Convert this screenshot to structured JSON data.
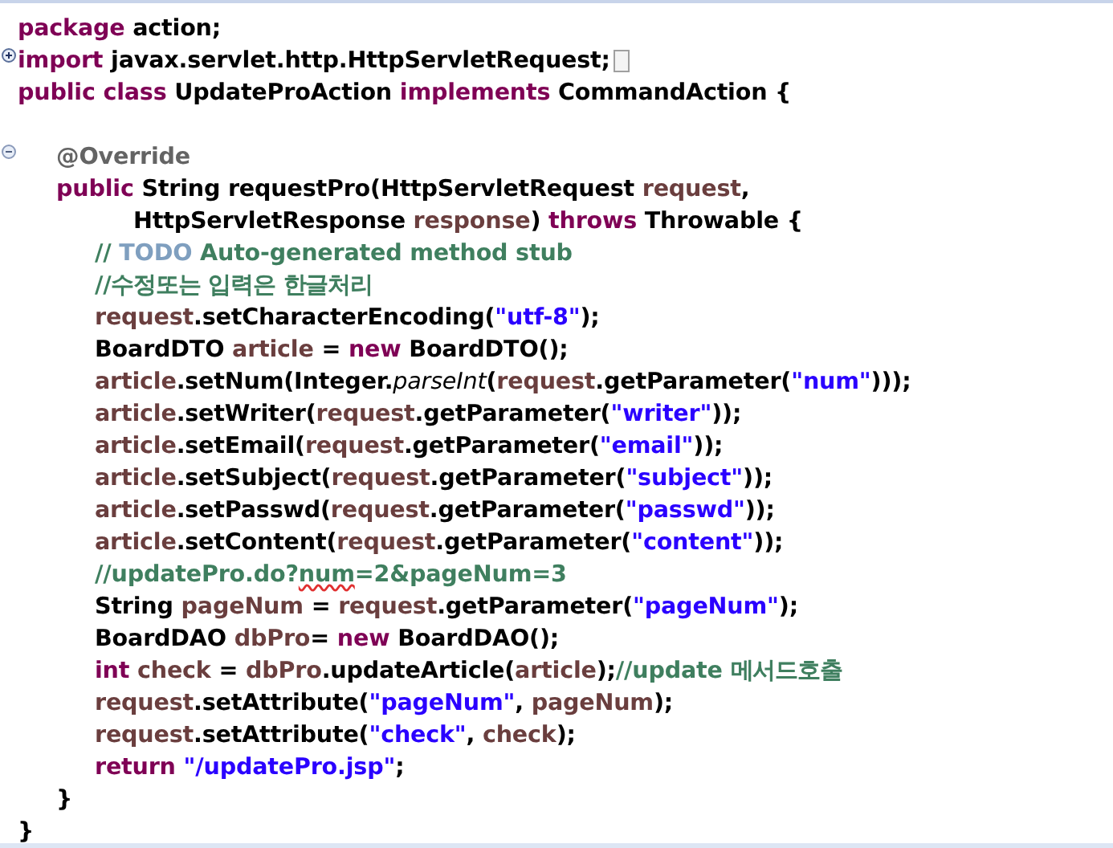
{
  "editor": {
    "lines": [
      {
        "tokens": [
          {
            "kind": "keyword",
            "text": "package"
          },
          {
            "kind": "plain",
            "text": " action;"
          }
        ]
      },
      {
        "fold_collapsed": true,
        "tokens": [
          {
            "kind": "keyword",
            "text": "import"
          },
          {
            "kind": "plain",
            "text": " javax.servlet.http.HttpServletRequest;"
          }
        ]
      },
      {
        "tokens": [
          {
            "kind": "keyword",
            "text": "public class"
          },
          {
            "kind": "plain",
            "text": " UpdateProAction "
          },
          {
            "kind": "keyword",
            "text": "implements"
          },
          {
            "kind": "plain",
            "text": " CommandAction {"
          }
        ]
      },
      {
        "kind": "blank"
      },
      {
        "fold_collapsed": false,
        "tokens": [
          {
            "kind": "annotation",
            "text": "\t@Override"
          }
        ]
      },
      {
        "tokens": [
          {
            "kind": "keyword",
            "text": "\tpublic"
          },
          {
            "kind": "plain",
            "text": " String requestPro(HttpServletRequest "
          },
          {
            "kind": "var",
            "text": "request"
          },
          {
            "kind": "plain",
            "text": ","
          }
        ]
      },
      {
        "tokens": [
          {
            "kind": "plain",
            "text": "\t\t\tHttpServletResponse "
          },
          {
            "kind": "var",
            "text": "response"
          },
          {
            "kind": "plain",
            "text": ") "
          },
          {
            "kind": "keyword",
            "text": "throws"
          },
          {
            "kind": "plain",
            "text": " Throwable {"
          }
        ]
      },
      {
        "tokens": [
          {
            "kind": "comment",
            "text": "\t\t// "
          },
          {
            "kind": "todo",
            "text": "TODO"
          },
          {
            "kind": "comment",
            "text": " Auto-generated method stub"
          }
        ]
      },
      {
        "tokens": [
          {
            "kind": "comment",
            "text": "\t\t//수정또는 입력은 한글처리"
          }
        ]
      },
      {
        "tokens": [
          {
            "kind": "var",
            "text": "\t\trequest"
          },
          {
            "kind": "plain",
            "text": ".setCharacterEncoding("
          },
          {
            "kind": "string",
            "text": "\"utf-8\""
          },
          {
            "kind": "plain",
            "text": ");"
          }
        ]
      },
      {
        "tokens": [
          {
            "kind": "plain",
            "text": "\t\tBoardDTO "
          },
          {
            "kind": "var",
            "text": "article"
          },
          {
            "kind": "plain",
            "text": " = "
          },
          {
            "kind": "keyword",
            "text": "new"
          },
          {
            "kind": "plain",
            "text": " BoardDTO();"
          }
        ]
      },
      {
        "tokens": [
          {
            "kind": "var",
            "text": "\t\tarticle"
          },
          {
            "kind": "plain",
            "text": ".setNum(Integer."
          },
          {
            "kind": "italic",
            "text": "parseInt"
          },
          {
            "kind": "plain",
            "text": "("
          },
          {
            "kind": "var",
            "text": "request"
          },
          {
            "kind": "plain",
            "text": ".getParameter("
          },
          {
            "kind": "string",
            "text": "\"num\""
          },
          {
            "kind": "plain",
            "text": ")));"
          }
        ]
      },
      {
        "tokens": [
          {
            "kind": "var",
            "text": "\t\tarticle"
          },
          {
            "kind": "plain",
            "text": ".setWriter("
          },
          {
            "kind": "var",
            "text": "request"
          },
          {
            "kind": "plain",
            "text": ".getParameter("
          },
          {
            "kind": "string",
            "text": "\"writer\""
          },
          {
            "kind": "plain",
            "text": "));"
          }
        ]
      },
      {
        "tokens": [
          {
            "kind": "var",
            "text": "\t\tarticle"
          },
          {
            "kind": "plain",
            "text": ".setEmail("
          },
          {
            "kind": "var",
            "text": "request"
          },
          {
            "kind": "plain",
            "text": ".getParameter("
          },
          {
            "kind": "string",
            "text": "\"email\""
          },
          {
            "kind": "plain",
            "text": "));"
          }
        ]
      },
      {
        "tokens": [
          {
            "kind": "var",
            "text": "\t\tarticle"
          },
          {
            "kind": "plain",
            "text": ".setSubject("
          },
          {
            "kind": "var",
            "text": "request"
          },
          {
            "kind": "plain",
            "text": ".getParameter("
          },
          {
            "kind": "string",
            "text": "\"subject\""
          },
          {
            "kind": "plain",
            "text": "));"
          }
        ]
      },
      {
        "tokens": [
          {
            "kind": "var",
            "text": "\t\tarticle"
          },
          {
            "kind": "plain",
            "text": ".setPasswd("
          },
          {
            "kind": "var",
            "text": "request"
          },
          {
            "kind": "plain",
            "text": ".getParameter("
          },
          {
            "kind": "string",
            "text": "\"passwd\""
          },
          {
            "kind": "plain",
            "text": "));"
          }
        ]
      },
      {
        "tokens": [
          {
            "kind": "var",
            "text": "\t\tarticle"
          },
          {
            "kind": "plain",
            "text": ".setContent("
          },
          {
            "kind": "var",
            "text": "request"
          },
          {
            "kind": "plain",
            "text": ".getParameter("
          },
          {
            "kind": "string",
            "text": "\"content\""
          },
          {
            "kind": "plain",
            "text": "));"
          }
        ]
      },
      {
        "tokens": [
          {
            "kind": "comment",
            "text": "\t\t//updatePro.do?"
          },
          {
            "kind": "misspelled",
            "text": "num"
          },
          {
            "kind": "comment",
            "text": "=2&pageNum=3"
          }
        ]
      },
      {
        "tokens": [
          {
            "kind": "plain",
            "text": "\t\tString "
          },
          {
            "kind": "var",
            "text": "pageNum"
          },
          {
            "kind": "plain",
            "text": " = "
          },
          {
            "kind": "var",
            "text": "request"
          },
          {
            "kind": "plain",
            "text": ".getParameter("
          },
          {
            "kind": "string",
            "text": "\"pageNum\""
          },
          {
            "kind": "plain",
            "text": ");"
          }
        ]
      },
      {
        "tokens": [
          {
            "kind": "plain",
            "text": "\t\tBoardDAO "
          },
          {
            "kind": "var",
            "text": "dbPro"
          },
          {
            "kind": "plain",
            "text": "= "
          },
          {
            "kind": "keyword",
            "text": "new"
          },
          {
            "kind": "plain",
            "text": " BoardDAO();"
          }
        ]
      },
      {
        "tokens": [
          {
            "kind": "keyword",
            "text": "\t\tint "
          },
          {
            "kind": "var",
            "text": "check"
          },
          {
            "kind": "plain",
            "text": " = "
          },
          {
            "kind": "var",
            "text": "dbPro"
          },
          {
            "kind": "plain",
            "text": ".updateArticle("
          },
          {
            "kind": "var",
            "text": "article"
          },
          {
            "kind": "plain",
            "text": ");"
          },
          {
            "kind": "comment",
            "text": "//update 메서드호출"
          }
        ]
      },
      {
        "tokens": [
          {
            "kind": "var",
            "text": "\t\trequest"
          },
          {
            "kind": "plain",
            "text": ".setAttribute("
          },
          {
            "kind": "string",
            "text": "\"pageNum\""
          },
          {
            "kind": "plain",
            "text": ", "
          },
          {
            "kind": "var",
            "text": "pageNum"
          },
          {
            "kind": "plain",
            "text": ");"
          }
        ]
      },
      {
        "tokens": [
          {
            "kind": "var",
            "text": "\t\trequest"
          },
          {
            "kind": "plain",
            "text": ".setAttribute("
          },
          {
            "kind": "string",
            "text": "\"check\""
          },
          {
            "kind": "plain",
            "text": ", "
          },
          {
            "kind": "var",
            "text": "check"
          },
          {
            "kind": "plain",
            "text": ");"
          }
        ]
      },
      {
        "tokens": [
          {
            "kind": "keyword",
            "text": "\t\treturn "
          },
          {
            "kind": "string",
            "text": "\"/updatePro.jsp\""
          },
          {
            "kind": "plain",
            "text": ";"
          }
        ]
      },
      {
        "tokens": [
          {
            "kind": "plain",
            "text": "\t}"
          }
        ]
      },
      {
        "tokens": [
          {
            "kind": "plain",
            "text": "}"
          }
        ]
      }
    ]
  }
}
